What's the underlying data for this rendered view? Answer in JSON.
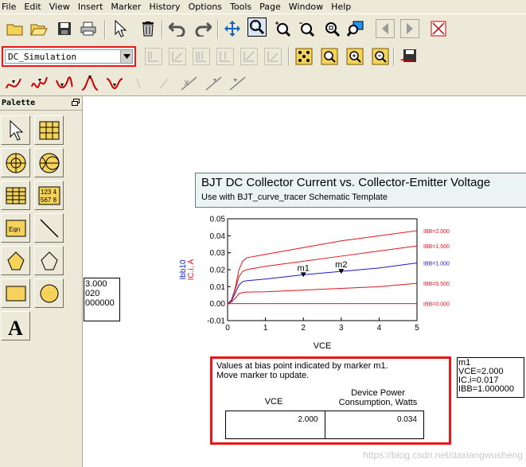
{
  "menu": [
    "File",
    "Edit",
    "View",
    "Insert",
    "Marker",
    "History",
    "Options",
    "Tools",
    "Page",
    "Window",
    "Help"
  ],
  "toolbar": {
    "icons": [
      "open-folder-icon",
      "open-folder-icon",
      "save-icon",
      "print-icon",
      "select-arrow-icon",
      "delete-icon",
      "undo-icon",
      "redo-icon",
      "move-icon",
      "zoom-box-icon",
      "zoom-in-icon",
      "zoom-out-icon",
      "zoom-fit-icon",
      "view-icon",
      "back-icon",
      "forward-icon",
      "close-icon"
    ]
  },
  "dataset": {
    "selected": "DC_Simulation"
  },
  "palette": {
    "title": "Palette"
  },
  "partial_box": [
    "3.000",
    "020",
    "000000"
  ],
  "plot_title": {
    "main": "BJT DC Collector Current vs. Collector-Emitter Voltage",
    "sub": "Use with BJT_curve_tracer Schematic Template"
  },
  "chart_data": {
    "type": "line",
    "xlabel": "VCE",
    "ylabel": [
      "Ibb10",
      "IC.i, A"
    ],
    "xlim": [
      0,
      5
    ],
    "ylim": [
      -0.01,
      0.05
    ],
    "x_ticks": [
      "0",
      "1",
      "2",
      "3",
      "4",
      "5"
    ],
    "y_ticks": [
      "0.05",
      "0.04",
      "0.03",
      "0.02",
      "0.01",
      "0.00",
      "-0.01"
    ],
    "x": [
      0,
      0.1,
      0.2,
      0.3,
      0.4,
      0.5,
      1,
      2,
      3,
      4,
      5
    ],
    "series": [
      {
        "name": "IBB=2.000",
        "color": "#e0141b",
        "values": [
          0,
          0.002,
          0.009,
          0.02,
          0.025,
          0.027,
          0.029,
          0.033,
          0.037,
          0.04,
          0.043
        ]
      },
      {
        "name": "IBB=1.500",
        "color": "#e0141b",
        "values": [
          0,
          0.002,
          0.008,
          0.016,
          0.019,
          0.02,
          0.022,
          0.025,
          0.028,
          0.031,
          0.034
        ]
      },
      {
        "name": "IBB=1.000",
        "color": "#1a1acc",
        "values": [
          0,
          0.0015,
          0.006,
          0.011,
          0.013,
          0.0135,
          0.0145,
          0.017,
          0.019,
          0.021,
          0.024
        ]
      },
      {
        "name": "IBB=0.500",
        "color": "#e0141b",
        "values": [
          0,
          0.001,
          0.003,
          0.006,
          0.0065,
          0.0068,
          0.007,
          0.008,
          0.009,
          0.01,
          0.012
        ]
      },
      {
        "name": "IBB=0.000",
        "color": "#e0141b",
        "values": [
          0,
          0,
          0,
          0,
          0,
          0,
          0,
          0,
          0,
          0,
          0
        ]
      }
    ],
    "markers": [
      {
        "name": "m1",
        "x": 2.0,
        "y": 0.017
      },
      {
        "name": "m2",
        "x": 3.0,
        "y": 0.019
      }
    ]
  },
  "marker_info": [
    "m1",
    "VCE=2.000",
    "IC.i=0.017",
    "IBB=1.000000"
  ],
  "bias_panel": {
    "note": "Values at bias point indicated by marker m1.\nMove marker to update.",
    "col1_header": "VCE",
    "col2_header": "Device Power\nConsumption, Watts",
    "vce_value": "2.000",
    "power_value": "0.034"
  },
  "watermark": "https://blog.csdn.net/daxiangwusheng"
}
